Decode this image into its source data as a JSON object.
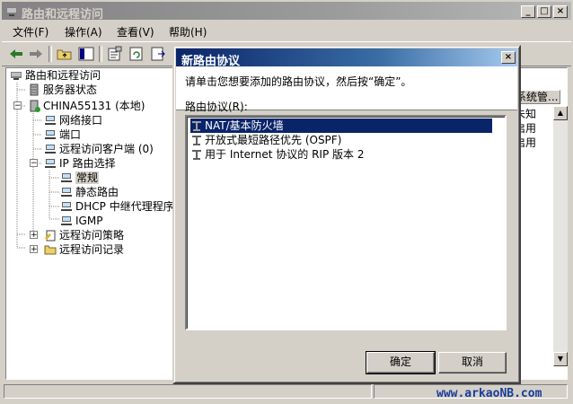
{
  "window": {
    "title": "路由和远程访问",
    "controls": {
      "minimize": "_",
      "maximize": "□",
      "close": "×"
    }
  },
  "menu": [
    {
      "label": "文件(F)"
    },
    {
      "label": "操作(A)"
    },
    {
      "label": "查看(V)"
    },
    {
      "label": "帮助(H)"
    }
  ],
  "tree": {
    "root": "路由和远程访问",
    "server_status": "服务器状态",
    "server": "CHINA55131 (本地)",
    "network_interfaces": "网络接口",
    "ports": "端口",
    "remote_clients": "远程访问客户端 (0)",
    "ip_routing": "IP 路由选择",
    "general": "常规",
    "static_routes": "静态路由",
    "dhcp_relay": "DHCP 中继代理程序",
    "igmp": "IGMP",
    "remote_policies": "远程访问策略",
    "remote_logging": "远程访问记录"
  },
  "right_pane": {
    "column_header": "系统管...",
    "cells": [
      "未知",
      "启用",
      "启用"
    ]
  },
  "dialog": {
    "title": "新路由协议",
    "close": "×",
    "instruction": "请单击您想要添加的路由协议，然后按“确定”。",
    "list_label": "路由协议(R):",
    "protocols": [
      {
        "label": "NAT/基本防火墙",
        "selected": true
      },
      {
        "label": "开放式最短路径优先 (OSPF)",
        "selected": false
      },
      {
        "label": "用于 Internet 协议的 RIP 版本 2",
        "selected": false
      }
    ],
    "ok": "确定",
    "cancel": "取消"
  },
  "watermark": "www.arkaoNB.com",
  "colors": {
    "title_active": "#0a246a",
    "title_inactive": "#848284",
    "face": "#d4d0c8",
    "selection": "#0a246a"
  }
}
